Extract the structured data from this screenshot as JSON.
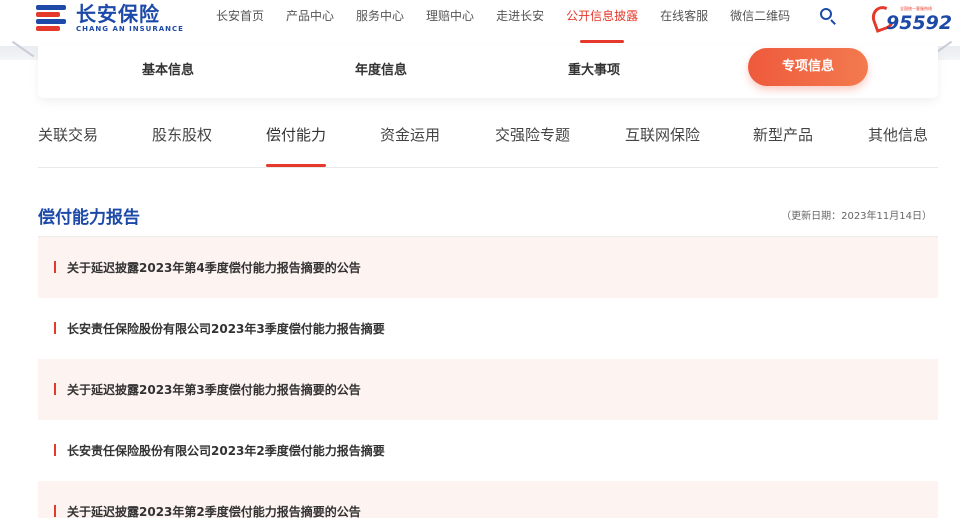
{
  "header": {
    "logo_cn": "长安保险",
    "logo_en": "CHANG AN INSURANCE",
    "nav": [
      {
        "label": "长安首页"
      },
      {
        "label": "产品中心"
      },
      {
        "label": "服务中心"
      },
      {
        "label": "理赔中心"
      },
      {
        "label": "走进长安"
      },
      {
        "label": "公开信息披露",
        "active": true
      },
      {
        "label": "在线客服"
      },
      {
        "label": "微信二维码"
      }
    ],
    "search_icon": "search-icon",
    "hotline_caption": "全国统一客服热线",
    "hotline_number": "95592"
  },
  "categories": [
    {
      "label": "基本信息"
    },
    {
      "label": "年度信息"
    },
    {
      "label": "重大事项"
    },
    {
      "label": "专项信息",
      "active": true
    }
  ],
  "subtabs": [
    {
      "label": "关联交易"
    },
    {
      "label": "股东股权"
    },
    {
      "label": "偿付能力",
      "active": true
    },
    {
      "label": "资金运用"
    },
    {
      "label": "交强险专题"
    },
    {
      "label": "互联网保险"
    },
    {
      "label": "新型产品"
    },
    {
      "label": "其他信息"
    }
  ],
  "section": {
    "title": "偿付能力报告",
    "update_date": "（更新日期：2023年11月14日）"
  },
  "reports": [
    {
      "title": "关于延迟披露2023年第4季度偿付能力报告摘要的公告"
    },
    {
      "title": "长安责任保险股份有限公司2023年3季度偿付能力报告摘要"
    },
    {
      "title": "关于延迟披露2023年第3季度偿付能力报告摘要的公告"
    },
    {
      "title": "长安责任保险股份有限公司2023年2季度偿付能力报告摘要"
    },
    {
      "title": "关于延迟披露2023年第2季度偿付能力报告摘要的公告"
    }
  ],
  "colors": {
    "brand_blue": "#1d4aa8",
    "accent_red": "#e4392b",
    "row_shade": "#fdf3f1"
  }
}
